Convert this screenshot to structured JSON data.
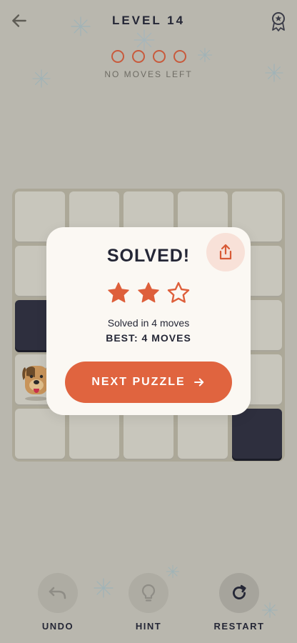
{
  "header": {
    "title": "LEVEL 14",
    "back_icon": "arrow-left-icon",
    "award_icon": "award-icon"
  },
  "moves": {
    "total": 4,
    "remaining": 0,
    "status": "NO MOVES LEFT"
  },
  "board": {
    "rows": 5,
    "cols": 5,
    "cells": [
      [
        "empty",
        "empty",
        "empty",
        "empty",
        "empty"
      ],
      [
        "empty",
        "empty",
        "empty",
        "empty",
        "empty"
      ],
      [
        "block",
        "empty",
        "empty",
        "empty",
        "empty"
      ],
      [
        "dog",
        "empty",
        "empty",
        "empty",
        "empty"
      ],
      [
        "empty",
        "empty",
        "empty",
        "empty",
        "block"
      ]
    ]
  },
  "modal": {
    "title": "SOLVED!",
    "stars_earned": 2,
    "stars_total": 3,
    "solved_text": "Solved in 4 moves",
    "best_text": "BEST: 4 MOVES",
    "next_label": "NEXT PUZZLE",
    "share_icon": "share-icon"
  },
  "toolbar": {
    "undo": "UNDO",
    "hint": "HINT",
    "restart": "RESTART"
  },
  "colors": {
    "accent": "#e0643f",
    "text_dark": "#252736",
    "block": "#2e2f3e",
    "background": "#b9b7ae",
    "modal": "#fbf8f3"
  }
}
